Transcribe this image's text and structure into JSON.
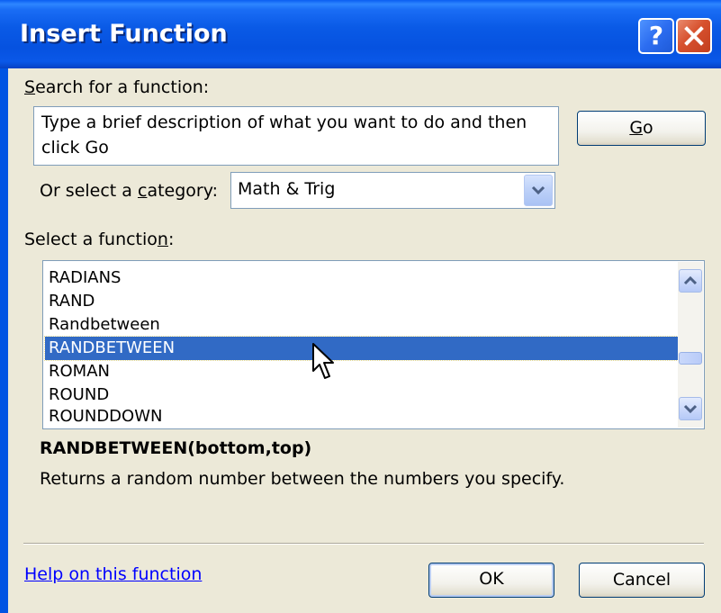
{
  "window": {
    "title": "Insert Function",
    "help_button": "?",
    "close_button": "close"
  },
  "search": {
    "label_prefix": "",
    "label_accel": "S",
    "label_rest": "earch for a function:",
    "textbox_line1": "Type a brief description of what you want to do and then",
    "textbox_line2": "click Go",
    "go_accel": "G",
    "go_rest": "o"
  },
  "category": {
    "label_prefix": "Or select a ",
    "label_accel": "c",
    "label_rest": "ategory:",
    "selected": "Math & Trig"
  },
  "function_list": {
    "label_prefix": "Select a functio",
    "label_accel": "n",
    "label_rest": ":",
    "items": [
      "RADIANS",
      "RAND",
      "Randbetween",
      "RANDBETWEEN",
      "ROMAN",
      "ROUND",
      "ROUNDDOWN"
    ],
    "selected_index": 3
  },
  "details": {
    "signature": "RANDBETWEEN(bottom,top)",
    "description": "Returns a random number between the numbers you specify."
  },
  "footer": {
    "help_link": "Help on this function",
    "ok_label": "OK",
    "cancel_label": "Cancel"
  },
  "icons": [
    "help-icon",
    "close-icon",
    "dropdown-arrow-icon",
    "scroll-up-icon",
    "scroll-down-icon",
    "mouse-cursor-icon"
  ],
  "colors": {
    "titlebar": "#0054e3",
    "dialog_bg": "#ece9d8",
    "selection": "#316ac5",
    "link": "#0000ff",
    "close_red": "#d7512e"
  }
}
